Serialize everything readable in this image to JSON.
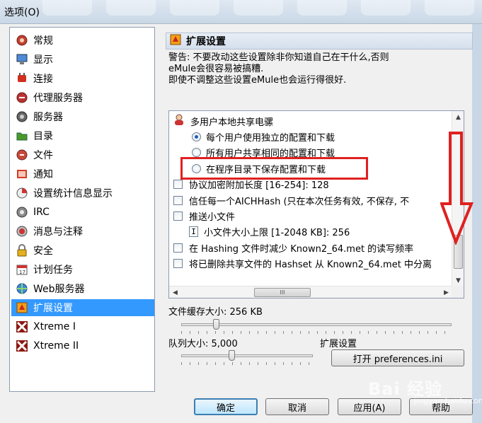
{
  "window": {
    "title": "选项(O)"
  },
  "sidebar": {
    "items": [
      {
        "label": "常规",
        "icon": "general-icon",
        "selected": false
      },
      {
        "label": "显示",
        "icon": "display-icon",
        "selected": false
      },
      {
        "label": "连接",
        "icon": "connection-icon",
        "selected": false
      },
      {
        "label": "代理服务器",
        "icon": "proxy-icon",
        "selected": false
      },
      {
        "label": "服务器",
        "icon": "server-icon",
        "selected": false
      },
      {
        "label": "目录",
        "icon": "folder-icon",
        "selected": false
      },
      {
        "label": "文件",
        "icon": "file-icon",
        "selected": false
      },
      {
        "label": "通知",
        "icon": "notify-icon",
        "selected": false
      },
      {
        "label": "设置统计信息显示",
        "icon": "statistics-icon",
        "selected": false
      },
      {
        "label": "IRC",
        "icon": "irc-icon",
        "selected": false
      },
      {
        "label": "消息与注释",
        "icon": "messages-icon",
        "selected": false
      },
      {
        "label": "安全",
        "icon": "security-icon",
        "selected": false
      },
      {
        "label": "计划任务",
        "icon": "scheduler-icon",
        "selected": false
      },
      {
        "label": "Web服务器",
        "icon": "webserver-icon",
        "selected": false
      },
      {
        "label": "扩展设置",
        "icon": "extended-icon",
        "selected": true
      },
      {
        "label": "Xtreme I",
        "icon": "xtreme-icon",
        "selected": false
      },
      {
        "label": "Xtreme II",
        "icon": "xtreme-icon",
        "selected": false
      }
    ]
  },
  "panel": {
    "title": "扩展设置",
    "warning_lines": [
      "警告: 不要改动这些设置除非你知道自己在干什么,否则",
      "eMule会很容易被搞糟.",
      "即使不调整这些设置eMule也会运行得很好."
    ]
  },
  "tree": {
    "group_label": "多用户本地共享电骡",
    "radios": [
      {
        "label": "每个用户使用独立的配置和下载",
        "checked": true
      },
      {
        "label": "所有用户共享相同的配置和下载",
        "checked": false
      },
      {
        "label": "在程序目录下保存配置和下载",
        "checked": false
      }
    ],
    "rows": [
      {
        "type": "checkbox",
        "label": "协议加密附加长度 [16-254]: 128",
        "indent": 0
      },
      {
        "type": "checkbox",
        "label": "信任每一个AICHHash (只在本次任务有效, 不保存, 不",
        "indent": 0
      },
      {
        "type": "checkbox",
        "label": "推送小文件",
        "indent": 0
      },
      {
        "type": "input",
        "label": "小文件大小上限 [1-2048 KB]: 256",
        "indent": 1,
        "glyph": "I"
      },
      {
        "type": "checkbox",
        "label": "在 Hashing 文件时减少 Known2_64.met 的读写频率",
        "indent": 0
      },
      {
        "type": "checkbox",
        "label": "将已删除共享文件的 Hashset 从 Known2_64.met 中分离",
        "indent": 0
      }
    ],
    "hscroll_glyph": "III"
  },
  "settings": {
    "file_buffer_label": "文件缓存大小: 256 KB",
    "file_buffer_value_fraction": 0.12,
    "queue_label": "队列大小: 5,000",
    "queue_value_fraction": 0.38,
    "extended_label": "扩展设置",
    "open_button": "打开 preferences.ini"
  },
  "buttons": {
    "ok": "确定",
    "cancel": "取消",
    "apply": "应用(A)",
    "help": "帮助"
  },
  "watermark": {
    "text": "Bai 经验",
    "sub": "jingyan.baidu.com"
  },
  "colors": {
    "selection": "#3399ff",
    "highlight": "#e02020"
  }
}
